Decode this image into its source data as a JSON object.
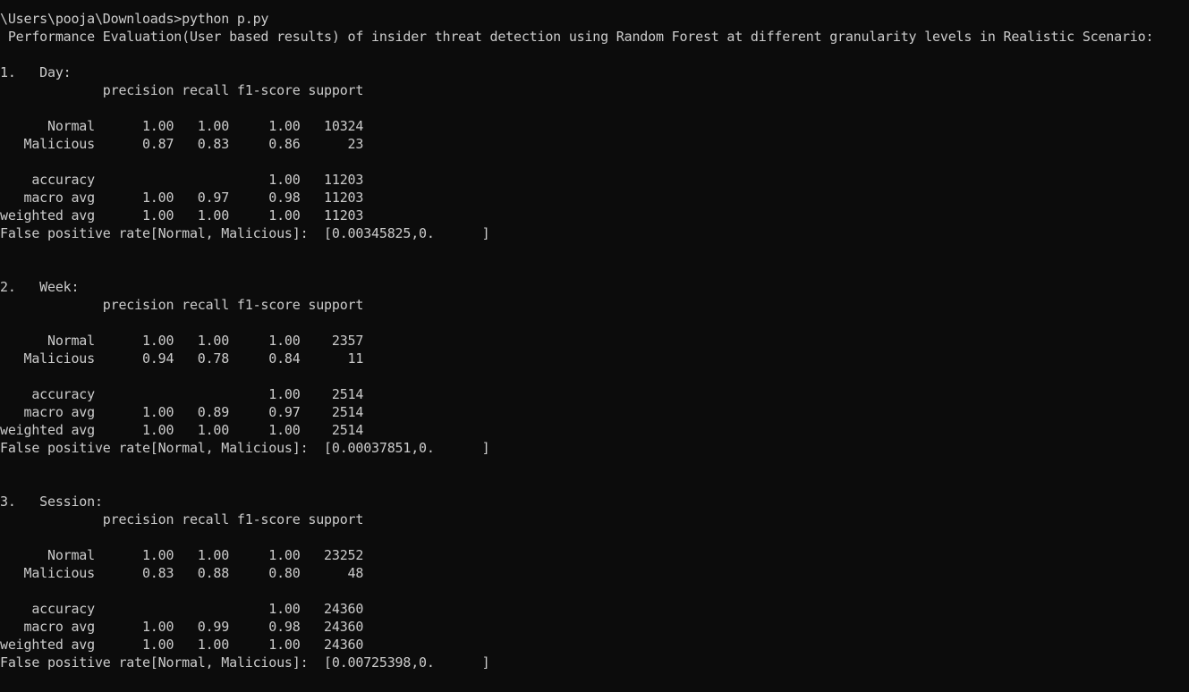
{
  "terminal": {
    "lines": [
      "\\Users\\pooja\\Downloads>python p.py",
      " Performance Evaluation(User based results) of insider threat detection using Random Forest at different granularity levels in Realistic Scenario:",
      "",
      "1.   Day:",
      "             precision recall f1-score support",
      "",
      "      Normal      1.00   1.00     1.00   10324",
      "   Malicious      0.87   0.83     0.86      23",
      "",
      "    accuracy                      1.00   11203",
      "   macro avg      1.00   0.97     0.98   11203",
      "weighted avg      1.00   1.00     1.00   11203",
      "False positive rate[Normal, Malicious]:  [0.00345825,0.      ]",
      "",
      "",
      "2.   Week:",
      "             precision recall f1-score support",
      "",
      "      Normal      1.00   1.00     1.00    2357",
      "   Malicious      0.94   0.78     0.84      11",
      "",
      "    accuracy                      1.00    2514",
      "   macro avg      1.00   0.89     0.97    2514",
      "weighted avg      1.00   1.00     1.00    2514",
      "False positive rate[Normal, Malicious]:  [0.00037851,0.      ]",
      "",
      "",
      "3.   Session:",
      "             precision recall f1-score support",
      "",
      "      Normal      1.00   1.00     1.00   23252",
      "   Malicious      0.83   0.88     0.80      48",
      "",
      "    accuracy                      1.00   24360",
      "   macro avg      1.00   0.99     0.98   24360",
      "weighted avg      1.00   1.00     1.00   24360",
      "False positive rate[Normal, Malicious]:  [0.00725398,0.      ]"
    ]
  }
}
